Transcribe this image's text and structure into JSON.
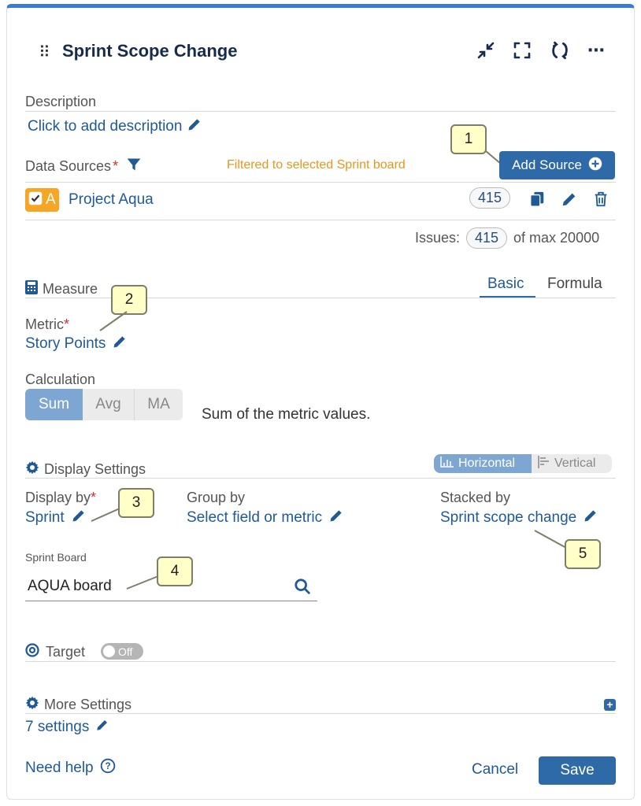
{
  "header": {
    "title": "Sprint Scope Change",
    "icons": [
      "drag-handle-icon",
      "collapse-icon",
      "fullscreen-icon",
      "refresh-icon",
      "more-icon"
    ]
  },
  "description": {
    "label": "Description",
    "link": "Click to add description"
  },
  "data_sources": {
    "label": "Data Sources",
    "required_mark": "*",
    "filter_note": "Filtered to selected Sprint board",
    "add_button": "Add Source",
    "source": {
      "badge": "A",
      "name": "Project Aqua",
      "count": "415"
    },
    "issues_label": "Issues:",
    "issues_count": "415",
    "issues_max": "of max 20000"
  },
  "measure": {
    "label": "Measure",
    "tabs": [
      "Basic",
      "Formula"
    ],
    "active_tab": "Basic",
    "metric_label": "Metric",
    "metric_value": "Story Points",
    "calculation_label": "Calculation",
    "calc_options": [
      "Sum",
      "Avg",
      "MA"
    ],
    "calc_selected": "Sum",
    "calc_description": "Sum of the metric values."
  },
  "display": {
    "label": "Display Settings",
    "orientation_options": [
      "Horizontal",
      "Vertical"
    ],
    "orientation_selected": "Horizontal",
    "display_by_label": "Display by",
    "display_by_value": "Sprint",
    "group_by_label": "Group by",
    "group_by_value": "Select field or metric",
    "stacked_by_label": "Stacked by",
    "stacked_by_value": "Sprint scope change",
    "sprint_board_label": "Sprint Board",
    "sprint_board_value": "AQUA board"
  },
  "target": {
    "label": "Target",
    "toggle": "Off"
  },
  "more": {
    "label": "More Settings",
    "link": "7 settings"
  },
  "footer": {
    "help": "Need help",
    "cancel": "Cancel",
    "save": "Save"
  },
  "callouts": [
    "1",
    "2",
    "3",
    "4",
    "5"
  ],
  "colors": {
    "accent": "#2f6aa8",
    "link": "#1f5a96",
    "warning": "#e8961e",
    "required": "#d32f2f",
    "callout_bg": "#ffffc8",
    "source_badge": "#f6a623"
  }
}
